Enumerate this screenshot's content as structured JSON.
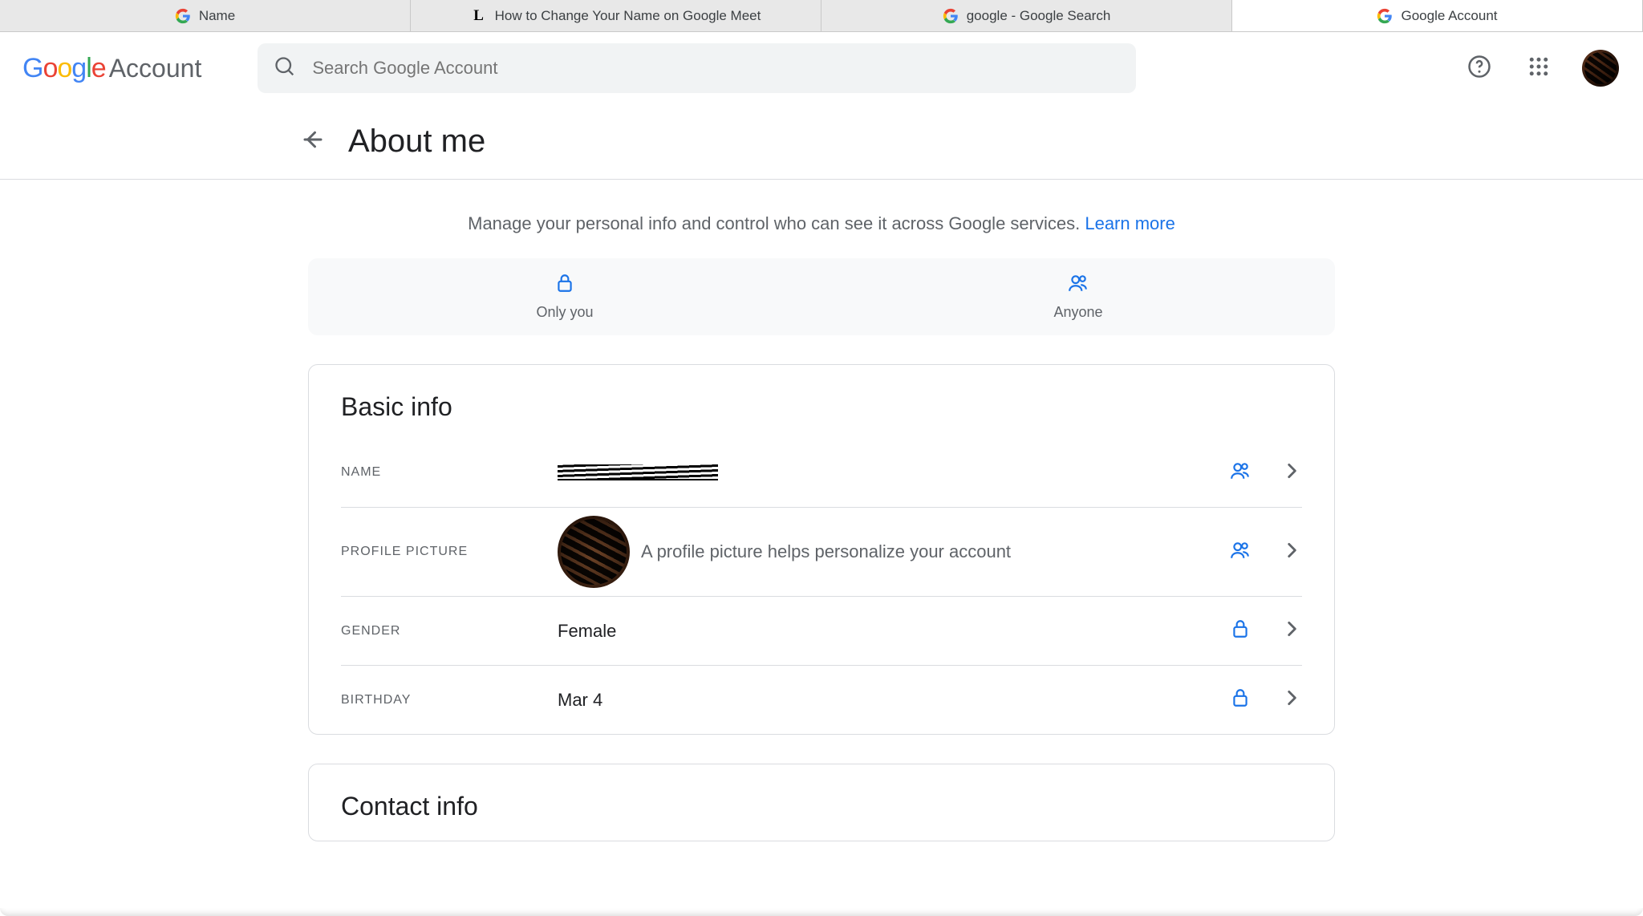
{
  "tabs": [
    {
      "label": "Name",
      "favicon": "google"
    },
    {
      "label": "How to Change Your Name on Google Meet",
      "favicon": "L"
    },
    {
      "label": "google - Google Search",
      "favicon": "google"
    },
    {
      "label": "Google Account",
      "favicon": "google",
      "active": true
    }
  ],
  "logo": {
    "word": "Google",
    "suffix": "Account"
  },
  "search": {
    "placeholder": "Search Google Account"
  },
  "page": {
    "title": "About me",
    "intro": "Manage your personal info and control who can see it across Google services.",
    "learn_more": "Learn more"
  },
  "legend": {
    "only_you": "Only you",
    "anyone": "Anyone"
  },
  "basic_info": {
    "heading": "Basic info",
    "rows": {
      "name": {
        "label": "NAME",
        "value_redacted": true,
        "visibility": "anyone"
      },
      "picture": {
        "label": "PROFILE PICTURE",
        "caption": "A profile picture helps personalize your account",
        "visibility": "anyone"
      },
      "gender": {
        "label": "GENDER",
        "value": "Female",
        "visibility": "only_you"
      },
      "birthday": {
        "label": "BIRTHDAY",
        "value": "Mar 4",
        "visibility": "only_you"
      }
    }
  },
  "contact_info": {
    "heading": "Contact info"
  },
  "icons": {
    "search": "search-icon",
    "help": "help-icon",
    "apps": "apps-grid-icon",
    "back": "arrow-left-icon",
    "lock": "lock-icon",
    "people": "people-icon",
    "chevron": "chevron-right-icon"
  },
  "colors": {
    "blue": "#1a73e8"
  }
}
